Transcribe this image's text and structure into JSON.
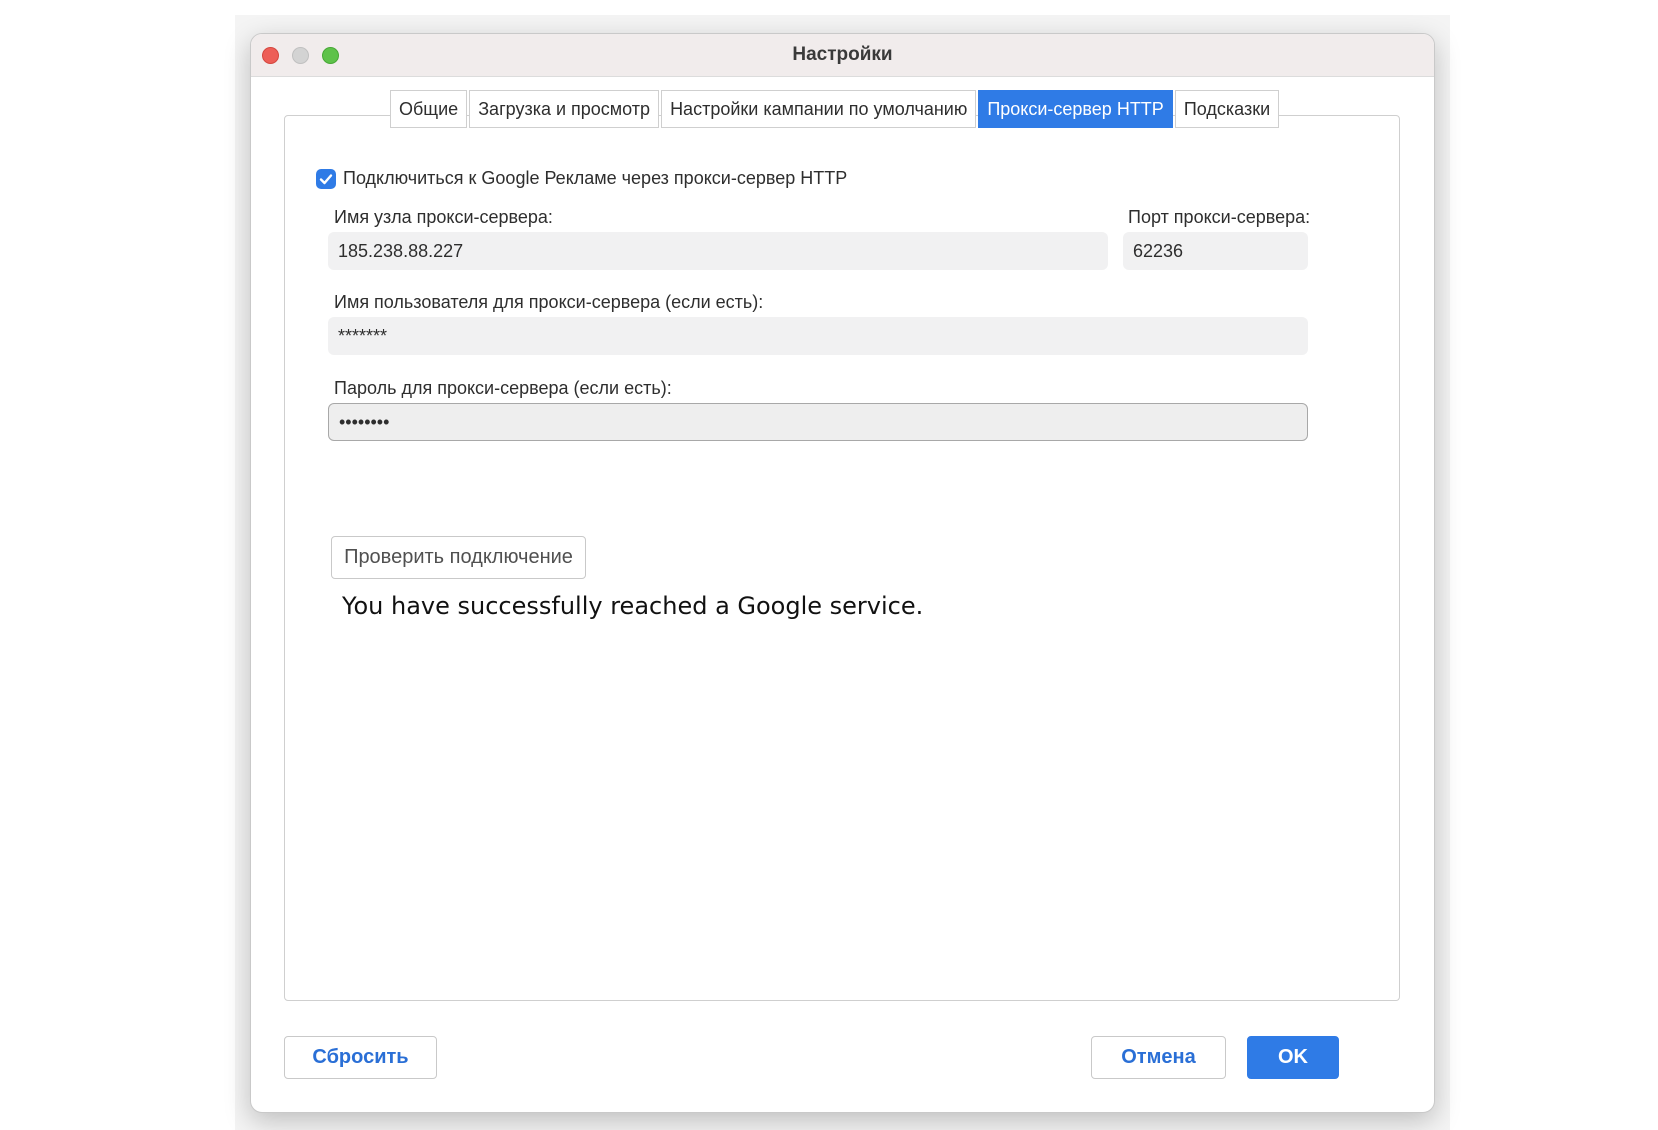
{
  "window": {
    "title": "Настройки"
  },
  "tabs": [
    {
      "label": "Общие"
    },
    {
      "label": "Загрузка и просмотр"
    },
    {
      "label": "Настройки кампании по умолчанию"
    },
    {
      "label": "Прокси-сервер HTTP",
      "active": true
    },
    {
      "label": "Подсказки"
    }
  ],
  "proxy": {
    "enable_label": "Подключиться к Google Рекламе через прокси-сервер HTTP",
    "enabled": true,
    "host_label": "Имя узла прокси-сервера:",
    "host_value": "185.238.88.227",
    "port_label": "Порт прокси-сервера:",
    "port_value": "62236",
    "user_label": "Имя пользователя для прокси-сервера (если есть):",
    "user_value": "*******",
    "password_label": "Пароль для прокси-сервера (если есть):",
    "password_value": "••••••••",
    "test_button": "Проверить подключение",
    "result_message": "You have successfully reached a Google service."
  },
  "footer": {
    "reset": "Сбросить",
    "cancel": "Отмена",
    "ok": "OK"
  },
  "colors": {
    "accent": "#2f7be6",
    "link_text": "#2a6fd6",
    "close": "#ed5e57",
    "minimize_disabled": "#d3d3d3",
    "zoom": "#5ec24a"
  }
}
